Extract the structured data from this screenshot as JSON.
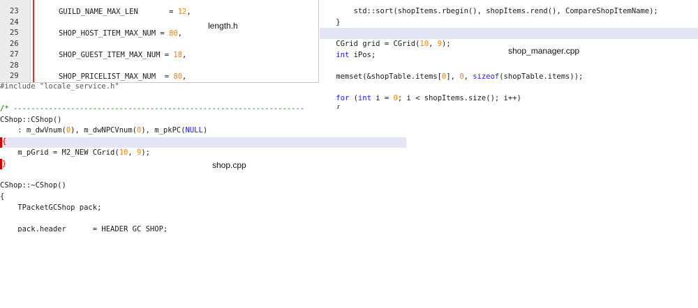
{
  "length_h": {
    "label": "length.h",
    "lines": [
      {
        "num": "23",
        "name": "GUILD_NAME_MAX_LEN",
        "pad": "       ",
        "value": "12"
      },
      {
        "num": "24",
        "name": "",
        "pad": "",
        "value": ""
      },
      {
        "num": "25",
        "name": "SHOP_HOST_ITEM_MAX_NUM",
        "pad": " ",
        "value": "80"
      },
      {
        "num": "26",
        "name": "",
        "pad": "",
        "value": ""
      },
      {
        "num": "27",
        "name": "SHOP_GUEST_ITEM_MAX_NUM",
        "pad": " ",
        "value": "18"
      },
      {
        "num": "28",
        "name": "",
        "pad": "",
        "value": ""
      },
      {
        "num": "29",
        "name": "SHOP_PRICELIST_MAX_NUM",
        "pad": "  ",
        "value": "80"
      }
    ]
  },
  "shop_cpp": {
    "label": "shop.cpp",
    "include_line": "#include \"locale_service.h\"",
    "comment_line": "/* ------------------------------------------------------------------",
    "ctor": "CShop::CShop()",
    "init_prefix": "    : m_dwVnum(",
    "init_zero1": "0",
    "init_mid": "), m_dwNPCVnum(",
    "init_zero2": "0",
    "init_mid2": "), m_pkPC(",
    "init_null": "NULL",
    "init_end": ")",
    "open_brace": "{",
    "grid_prefix": "    m_pGrid = M2_NEW CGrid(",
    "grid_a": "10",
    "grid_sep": ", ",
    "grid_b": "9",
    "grid_end": ");",
    "close_brace": "}",
    "dtor": "CShop::~CShop()",
    "open_brace2": "{",
    "packet_line": "    TPacketGCShop pack;",
    "header_line": "    pack.header      = HEADER_GC_SHOP;"
  },
  "shop_manager_cpp": {
    "label": "shop_manager.cpp",
    "sort_line": "        std::sort(shopItems.rbegin(), shopItems.rend(), CompareShopItemName);",
    "close_brace": "    }",
    "grid_prefix": "    CGrid grid = CGrid(",
    "grid_a": "10",
    "grid_b": "9",
    "grid_end": ");",
    "int_kw": "int",
    "ipos": " iPos;",
    "memset_prefix": "    memset(&shopTable.items[",
    "memset_idx": "0",
    "memset_mid": "], ",
    "memset_zero": "0",
    "memset_sep": ", ",
    "sizeof_kw": "sizeof",
    "memset_end": "(shopTable.items));",
    "for_kw": "for",
    "for_open": " (",
    "for_int": "int",
    "for_mid": " i = ",
    "for_zero": "0",
    "for_end": "; i < shopItems.size(); i++)",
    "partial_brace": "    {"
  }
}
